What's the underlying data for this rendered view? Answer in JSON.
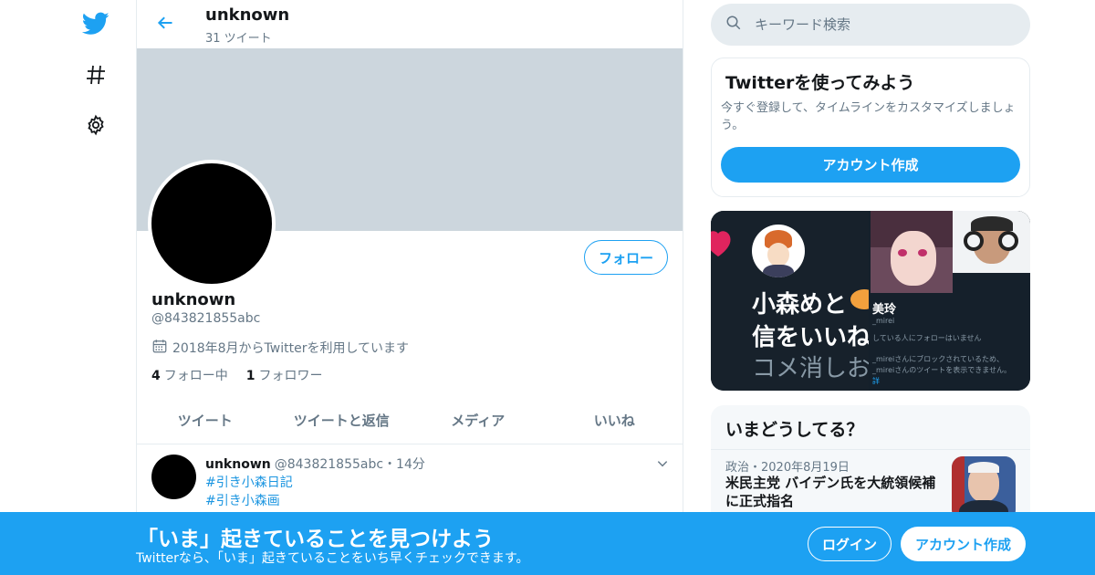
{
  "profile": {
    "name": "unknown",
    "tweet_count": "31 ツイート",
    "handle": "@843821855abc",
    "joined": "2018年8月からTwitterを利用しています",
    "following_count": "4",
    "following_label": "フォロー中",
    "followers_count": "1",
    "followers_label": "フォロワー",
    "follow_button": "フォロー"
  },
  "tabs": [
    "ツイート",
    "ツイートと返信",
    "メディア",
    "いいね"
  ],
  "tweet": {
    "author": "unknown",
    "handle": "@843821855abc",
    "time": "・14分",
    "hashtags": [
      "#引き小森日記",
      "#引き小森画"
    ]
  },
  "search": {
    "placeholder": "キーワード検索"
  },
  "signup_card": {
    "title": "Twitterを使ってみよう",
    "description": "今すぐ登録して、タイムラインをカスタマイズしましょう。",
    "button": "アカウント作成"
  },
  "media": {
    "left_lines": [
      "小森めと",
      "信をいいね",
      "コメ消しお"
    ],
    "right_name": "美玲",
    "right_handle": "_mirei",
    "right_small_1": "している人にフォローはいません",
    "right_small_2": "_mireiさんにブロックされているため、",
    "right_small_3": "_mireiさんのツイートを表示できません。",
    "right_small_4": "詳"
  },
  "trends": {
    "title": "いまどうしてる？",
    "category": "政治・2020年8月19日",
    "headline": "米民主党 バイデン氏を大統領候補に正式指名"
  },
  "bottom_bar": {
    "title": "「いま」起きていることを見つけよう",
    "subtitle": "Twitterなら、「いま」起きていることをいち早くチェックできます。",
    "login": "ログイン",
    "signup": "アカウント作成"
  },
  "colors": {
    "accent": "#1da1f2",
    "banner": "#ccd6dd",
    "muted": "#657786",
    "border": "#e6ecf0"
  },
  "icons": [
    "twitter-bird-icon",
    "hashtag-icon",
    "gear-icon",
    "back-arrow-icon",
    "calendar-icon",
    "search-icon",
    "chevron-down-icon"
  ]
}
